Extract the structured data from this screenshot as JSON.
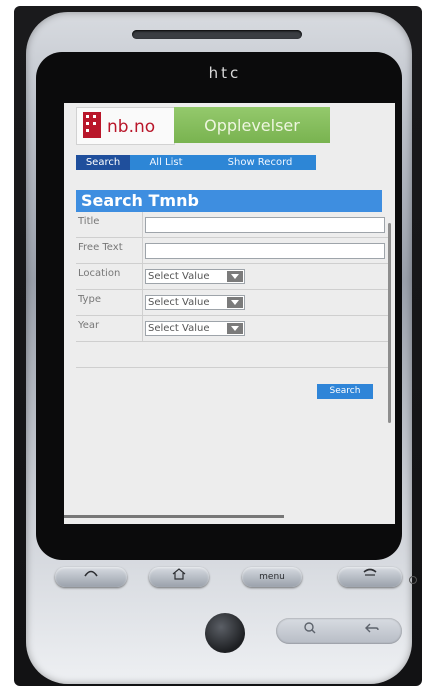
{
  "device": {
    "brand": "htc"
  },
  "logo": {
    "text": "nb.no",
    "banner": "Opplevelser"
  },
  "tabs": [
    {
      "label": "Search",
      "active": true
    },
    {
      "label": "All List",
      "active": false
    },
    {
      "label": "Show Record",
      "active": false
    }
  ],
  "form": {
    "title": "Search Tmnb",
    "fields": [
      {
        "label": "Title",
        "type": "text",
        "value": ""
      },
      {
        "label": "Free Text",
        "type": "text",
        "value": ""
      },
      {
        "label": "Location",
        "type": "select",
        "value": "Select Value"
      },
      {
        "label": "Type",
        "type": "select",
        "value": "Select Value"
      },
      {
        "label": "Year",
        "type": "select",
        "value": "Select Value"
      }
    ],
    "submit": "Search"
  },
  "hardware_buttons": {
    "menu": "menu"
  },
  "colors": {
    "accent_blue": "#3e8ee0",
    "tab_bar": "#2d86d6",
    "tab_active": "#1f4f9c",
    "logo_red": "#b9162a",
    "logo_green": "#79b350"
  }
}
